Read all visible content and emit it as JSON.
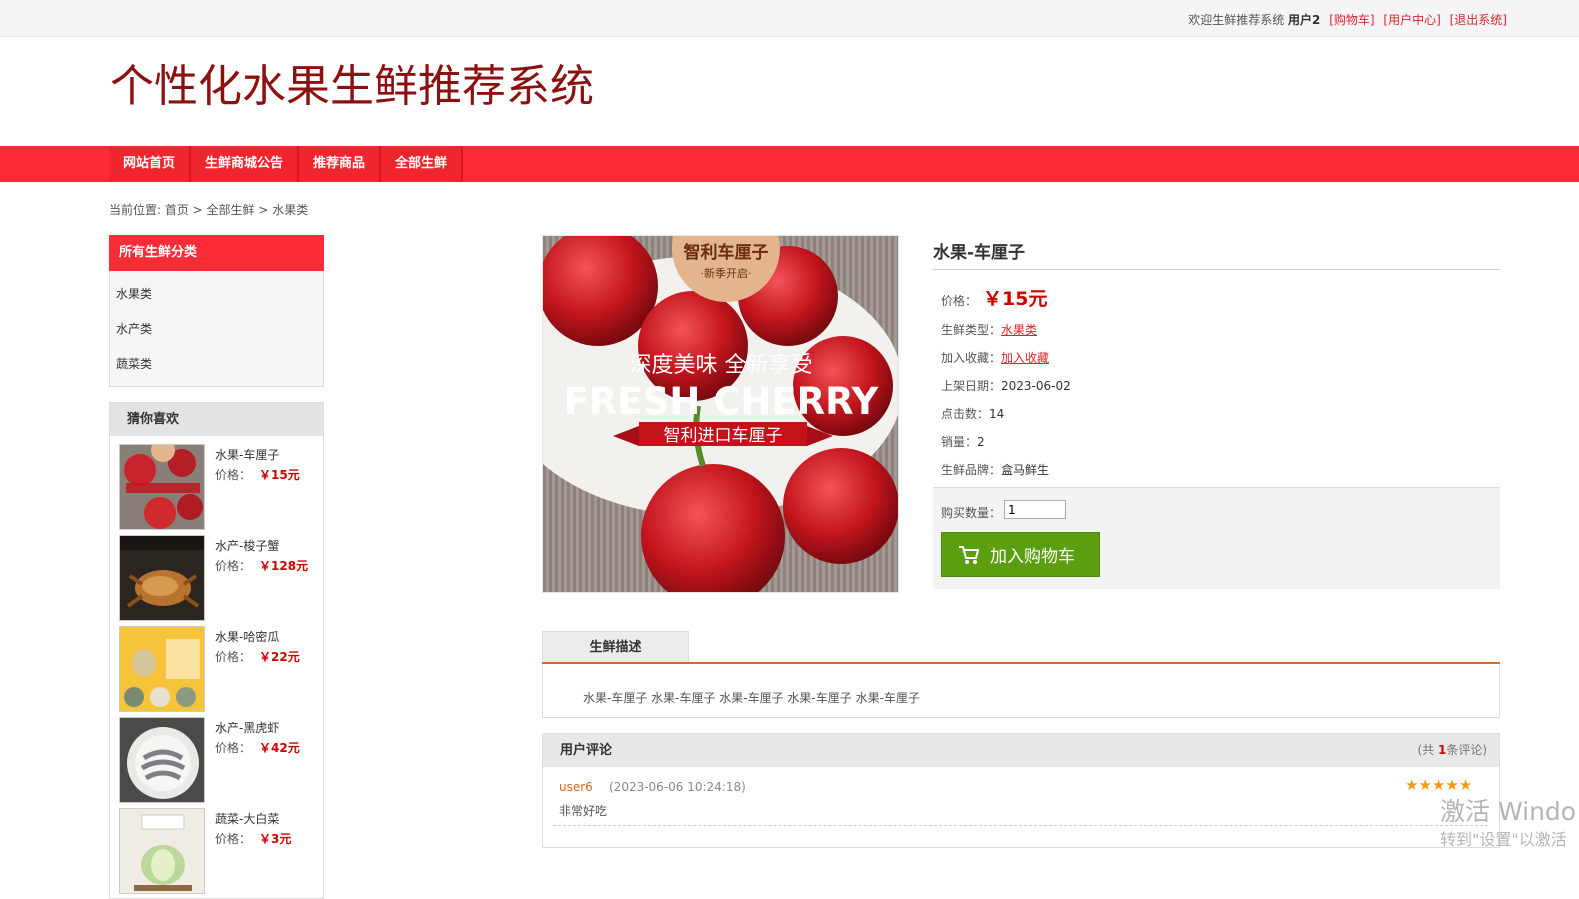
{
  "topbar": {
    "welcome": "欢迎生鲜推荐系统",
    "username": "用户2",
    "cart_link": "[购物车]",
    "user_center_link": "[用户中心]",
    "logout_link": "[退出系统]"
  },
  "site": {
    "title": "个性化水果生鲜推荐系统"
  },
  "nav": {
    "items": [
      {
        "label": "网站首页"
      },
      {
        "label": "生鲜商城公告"
      },
      {
        "label": "推荐商品"
      },
      {
        "label": "全部生鲜"
      }
    ]
  },
  "breadcrumb": {
    "text": "当前位置: 首页 > 全部生鲜 > 水果类"
  },
  "sidebar": {
    "category_title": "所有生鲜分类",
    "categories": [
      {
        "label": "水果类"
      },
      {
        "label": "水产类"
      },
      {
        "label": "蔬菜类"
      }
    ],
    "guess_title": "猜你喜欢",
    "price_label": "价格：",
    "guess_items": [
      {
        "name": "水果-车厘子",
        "price": "￥15元"
      },
      {
        "name": "水产-梭子蟹",
        "price": "￥128元"
      },
      {
        "name": "水果-哈密瓜",
        "price": "￥22元"
      },
      {
        "name": "水产-黑虎虾",
        "price": "￥42元"
      },
      {
        "name": "蔬菜-大白菜",
        "price": "￥3元"
      }
    ]
  },
  "product": {
    "title": "水果-车厘子",
    "image_text": {
      "badge_line1": "智利车厘子",
      "badge_line2": "·新季开启·",
      "slogan": "深度美味 全新享受",
      "headline": "FRESH CHERRY",
      "banner": "智利进口车厘子"
    },
    "price_label": "价格：",
    "price": "￥15元",
    "type_label": "生鲜类型：",
    "type_value": "水果类",
    "fav_label": "加入收藏：",
    "fav_link": "加入收藏",
    "date_label": "上架日期：",
    "date_value": "2023-06-02",
    "clicks_label": "点击数：",
    "clicks_value": "14",
    "sales_label": "销量：",
    "sales_value": "2",
    "brand_label": "生鲜品牌：",
    "brand_value": "盒马鲜生",
    "qty_label": "购买数量：",
    "qty_value": "1",
    "cart_button": "加入购物车"
  },
  "description": {
    "tab": "生鲜描述",
    "text": "水果-车厘子 水果-车厘子 水果-车厘子 水果-车厘子 水果-车厘子"
  },
  "reviews": {
    "title": "用户评论",
    "count_prefix": "(共 ",
    "count": "1",
    "count_suffix": "条评论)",
    "items": [
      {
        "user": "user6",
        "time": "(2023-06-06 10:24:18)",
        "text": "非常好吃",
        "stars": 5
      }
    ]
  },
  "watermark": {
    "line1": "激活 Windo",
    "line2": "转到\"设置\"以激活"
  },
  "colors": {
    "accent_red": "#fc2c36",
    "title_red": "#8c1010",
    "price_red": "#d10000",
    "button_green": "#5b9e10",
    "tab_orange": "#e0661a"
  }
}
